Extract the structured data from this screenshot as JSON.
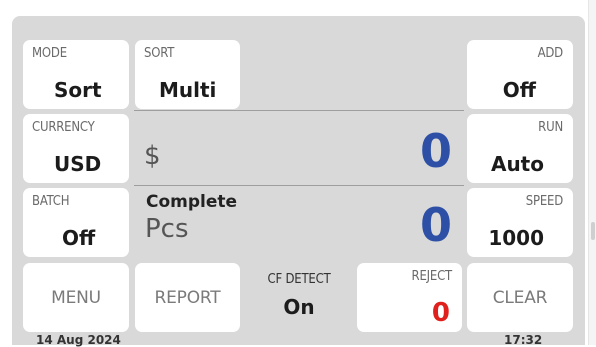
{
  "left": {
    "mode": {
      "label": "MODE",
      "value": "Sort"
    },
    "currency": {
      "label": "CURRENCY",
      "value": "USD"
    },
    "batch": {
      "label": "BATCH",
      "value": "Off"
    },
    "menu_label": "MENU"
  },
  "top": {
    "sort": {
      "label": "SORT",
      "value": "Multi"
    }
  },
  "right": {
    "add": {
      "label": "ADD",
      "value": "Off"
    },
    "run": {
      "label": "RUN",
      "value": "Auto"
    },
    "speed": {
      "label": "SPEED",
      "value": "1000"
    },
    "clear_label": "CLEAR"
  },
  "display": {
    "currency_symbol": "$",
    "amount": "0",
    "status_title": "Complete",
    "unit": "Pcs",
    "pieces": "0"
  },
  "bottom": {
    "report_label": "REPORT",
    "cf_detect": {
      "label": "CF DETECT",
      "value": "On"
    },
    "reject": {
      "label": "REJECT",
      "value": "0"
    }
  },
  "footer": {
    "date": "14 Aug 2024",
    "time": "17:32"
  },
  "colors": {
    "accent_blue": "#2d50a6",
    "reject_red": "#e0201c"
  }
}
